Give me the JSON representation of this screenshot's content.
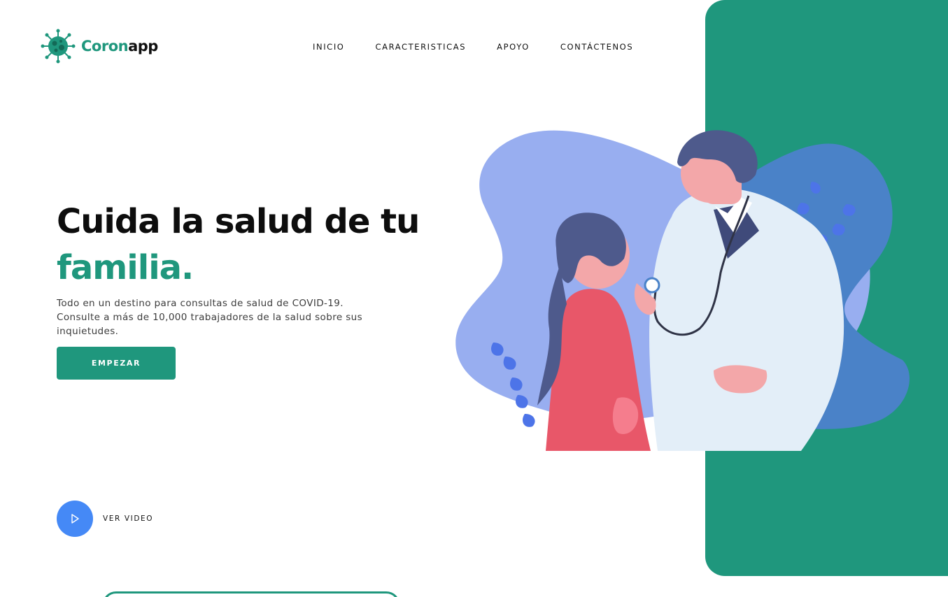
{
  "brand": {
    "name_part1": "Coron",
    "name_part2": "app",
    "logo_icon": "virus-icon",
    "accent_color": "#1f977d"
  },
  "nav": {
    "items": [
      "INICIO",
      "CARACTERISTICAS",
      "APOYO",
      "CONTÁCTENOS"
    ]
  },
  "hero": {
    "title_line1": "Cuida la salud de tu",
    "title_line2": "familia.",
    "description": "Todo en un destino para consultas de salud de COVID-19. Consulte a más de 10,000 trabajadores de la salud sobre sus inquietudes.",
    "cta_label": "EMPEZAR"
  },
  "video": {
    "label": "VER VIDEO",
    "icon": "play-icon",
    "button_color": "#4589f6"
  },
  "colors": {
    "accent": "#1f977d",
    "panel": "#1f977d",
    "blob_light": "#98aef0",
    "blob_dark": "#4a82c8"
  }
}
